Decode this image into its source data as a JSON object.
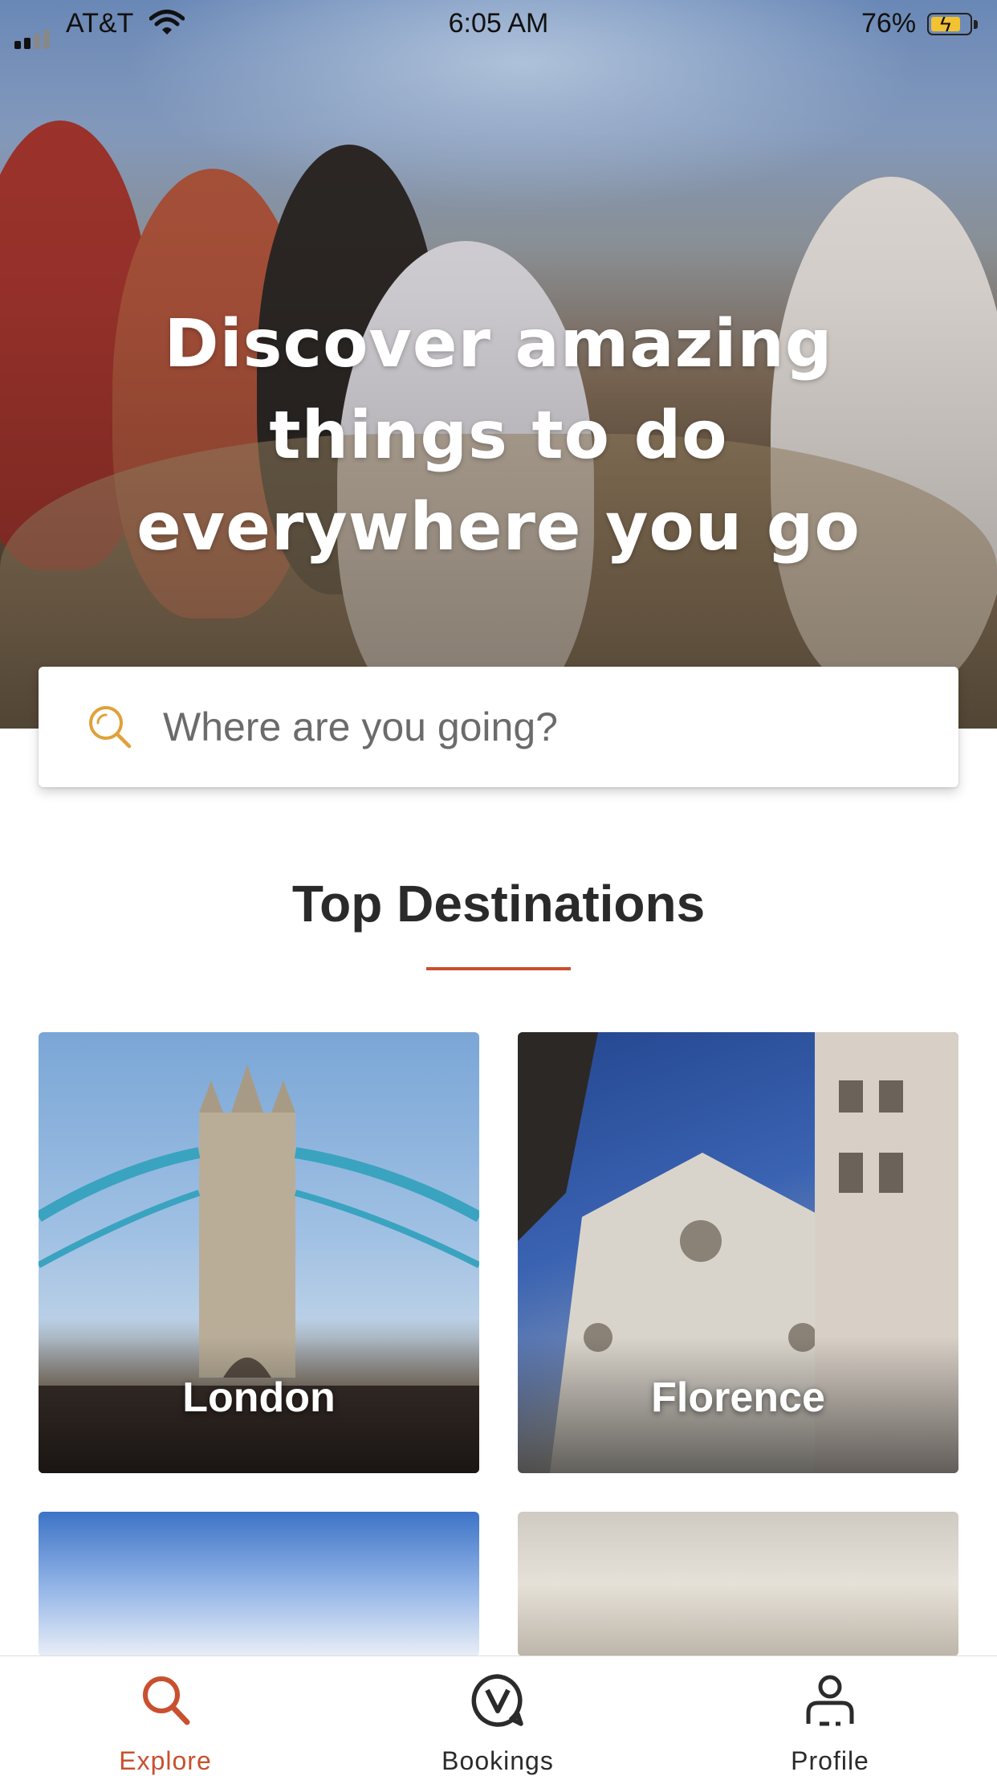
{
  "status_bar": {
    "carrier": "AT&T",
    "time": "6:05 AM",
    "battery": "76%"
  },
  "hero": {
    "title_line1": "Discover amazing",
    "title_line2": "things to do",
    "title_line3": "everywhere you go"
  },
  "search": {
    "placeholder": "Where are you going?",
    "icon": "search-icon"
  },
  "section": {
    "title": "Top Destinations"
  },
  "destinations": [
    {
      "label": "London"
    },
    {
      "label": "Florence"
    },
    {
      "label": ""
    },
    {
      "label": ""
    }
  ],
  "tabs": [
    {
      "label": "Explore",
      "icon": "search-icon",
      "active": true
    },
    {
      "label": "Bookings",
      "icon": "bookings-icon",
      "active": false
    },
    {
      "label": "Profile",
      "icon": "profile-icon",
      "active": false
    }
  ],
  "colors": {
    "accent": "#c9502f",
    "search_icon": "#e0a13a"
  }
}
